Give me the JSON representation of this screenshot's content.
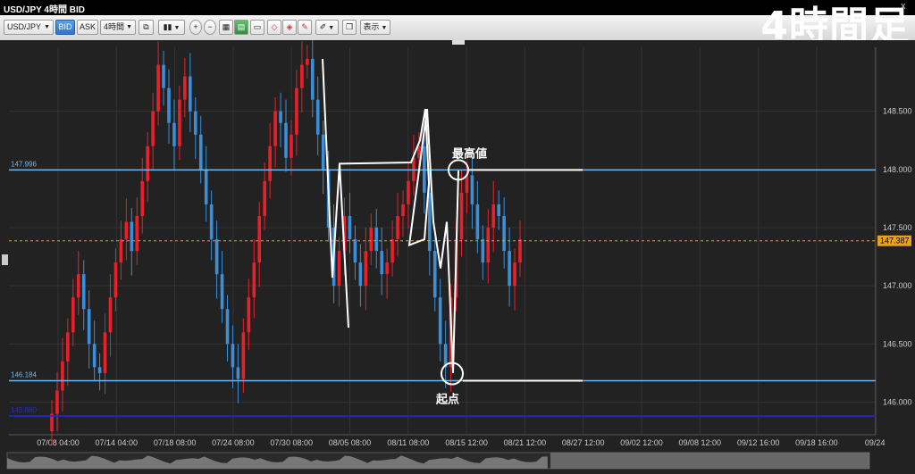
{
  "window": {
    "title": "USD/JPY 4時間 BID",
    "close_glyph": "x"
  },
  "overlay_label": "4時間足",
  "toolbar": {
    "symbol": "USD/JPY",
    "bid_label": "BID",
    "ask_label": "ASK",
    "timeframe": "4時間",
    "display_label": "表示"
  },
  "colors": {
    "bull": "#e8202a",
    "bear": "#3a8fd8",
    "level_light_blue": "#6fb6f2",
    "level_dark_blue": "#1f2ad8",
    "current_price": "#e6a21a",
    "annotation": "#ffffff"
  },
  "icons": [
    "candle-chart-icon",
    "zoom-in-icon",
    "zoom-out-icon",
    "grid-icon",
    "color-icon",
    "window-icon",
    "draw-icon",
    "pen-icon",
    "copy-icon"
  ],
  "chart_data": {
    "type": "candlestick",
    "yticks": [
      146.0,
      146.5,
      147.0,
      147.5,
      148.0,
      148.5
    ],
    "ytick_labels": [
      "146.000",
      "146.500",
      "147.000",
      "147.500",
      "148.000",
      "148.500"
    ],
    "ylim": [
      145.72,
      149.05
    ],
    "xtick_labels": [
      "07/08 04:00",
      "07/14 04:00",
      "07/18 08:00",
      "07/24 08:00",
      "07/30 08:00",
      "08/05 08:00",
      "08/11 08:00",
      "08/15 12:00",
      "08/21 12:00",
      "08/27 12:00",
      "09/02 12:00",
      "09/08 12:00",
      "09/12 16:00",
      "09/18 16:00",
      "09/24"
    ],
    "levels": [
      {
        "label": "147.996",
        "value": 147.996,
        "color": "#6fb6f2"
      },
      {
        "label": "146.184",
        "value": 146.184,
        "color": "#6fb6f2"
      },
      {
        "label": "145.880",
        "value": 145.88,
        "color": "#1f2ad8"
      }
    ],
    "current_price": {
      "label": "147.387",
      "value": 147.387
    },
    "annotations": {
      "high_label": "最高値",
      "start_label": "起点"
    },
    "close_series": [
      145.9,
      146.1,
      146.35,
      146.6,
      146.9,
      147.1,
      146.8,
      146.5,
      146.3,
      146.25,
      146.6,
      146.9,
      147.2,
      147.4,
      147.55,
      147.3,
      147.6,
      147.9,
      148.2,
      148.5,
      148.9,
      148.7,
      148.4,
      148.2,
      148.6,
      148.8,
      148.5,
      148.3,
      148.0,
      147.7,
      147.4,
      147.1,
      146.8,
      146.5,
      146.3,
      146.2,
      146.6,
      146.9,
      147.2,
      147.6,
      147.9,
      148.2,
      148.5,
      148.4,
      148.1,
      148.3,
      148.7,
      148.9,
      148.95,
      148.6,
      148.3,
      148.0,
      147.5,
      147.0,
      147.3,
      147.6,
      147.4,
      147.2,
      147.0,
      147.3,
      147.5,
      147.3,
      147.1,
      147.2,
      147.4,
      147.6,
      147.7,
      147.9,
      148.1,
      148.2,
      147.8,
      147.3,
      146.9,
      146.5,
      146.3,
      146.9,
      147.4,
      147.8,
      147.95,
      147.7,
      147.4,
      147.2,
      147.5,
      147.7,
      147.6,
      147.3,
      147.0,
      147.2,
      147.4
    ]
  }
}
